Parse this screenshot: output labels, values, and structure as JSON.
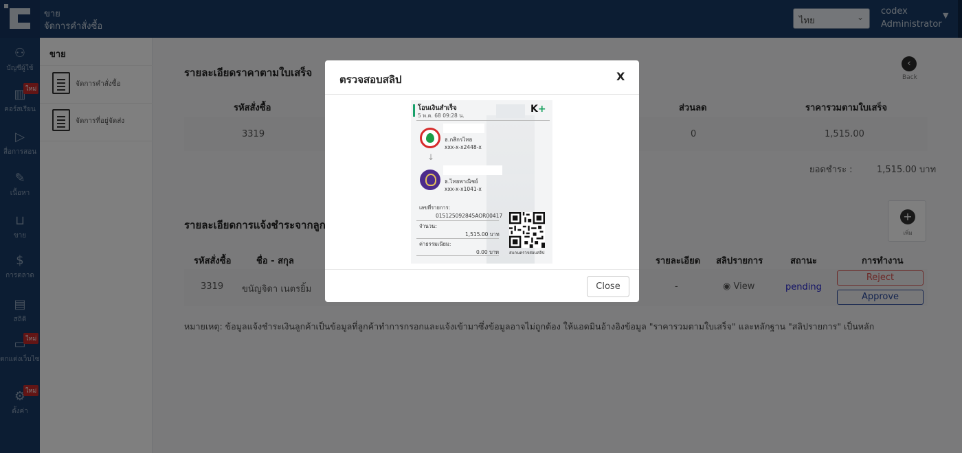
{
  "header": {
    "crumb_section": "ขาย",
    "crumb_page": "จัดการคำสั่งซื้อ",
    "language": "ไทย",
    "user_name": "codex",
    "user_role": "Administrator"
  },
  "rail": {
    "items": [
      {
        "label": "บัญชีผู้ใช้",
        "icon": "users-icon"
      },
      {
        "label": "คอร์สเรียน",
        "icon": "course-icon",
        "badge": "ใหม่"
      },
      {
        "label": "สื่อการสอน",
        "icon": "media-icon"
      },
      {
        "label": "เนื้อหา",
        "icon": "content-icon"
      },
      {
        "label": "ขาย",
        "icon": "basket-icon"
      },
      {
        "label": "การตลาด",
        "icon": "marketing-icon"
      },
      {
        "label": "สถิติ",
        "icon": "stats-icon"
      },
      {
        "label": "ตกแต่งเว็บไซต์",
        "icon": "website-icon",
        "badge": "ใหม่"
      },
      {
        "label": "ตั้งค่า",
        "icon": "settings-icon",
        "badge": "ใหม่"
      }
    ]
  },
  "submenu": {
    "title": "ขาย",
    "items": [
      {
        "label": "จัดการคำสั่งซื้อ"
      },
      {
        "label": "จัดการที่อยู่จัดส่ง"
      }
    ]
  },
  "invoice": {
    "title": "รายละเอียดราคาตามใบเสร็จ",
    "col_order_id": "รหัสสั่งซื้อ",
    "col_discount": "ส่วนลด",
    "col_total": "ราคารวมตามใบเสร็จ",
    "order_id": "3319",
    "discount": "0",
    "total": "1,515.00",
    "paid_label": "ยอดชำระ :",
    "paid_value": "1,515.00 บาท",
    "back_label": "Back"
  },
  "payment": {
    "title": "รายละเอียดการแจ้งชำระจากลูกค้า",
    "add_label": "เพิ่ม",
    "columns": {
      "order_id": "รหัสสั่งซื้อ",
      "name": "ชื่อ - สกุล",
      "detail": "รายละเอียด",
      "slip": "สลิปรายการ",
      "status": "สถานะ",
      "action": "การทำงาน"
    },
    "row": {
      "order_id": "3319",
      "name": "ขนัญจิดา เนตรยิ้ม",
      "detail": "-",
      "slip_btn": "View",
      "status": "pending",
      "reject": "Reject",
      "approve": "Approve"
    },
    "note": "หมายเหตุ: ข้อมูลแจ้งชำระเงินลูกค้าเป็นข้อมูลที่ลูกค้าทำการกรอกและแจ้งเข้ามาซึ่งข้อมูลอาจไม่ถูกต้อง ให้แอดมินอ้างอิงข้อมูล \"ราคารวมตามใบเสร็จ\" และหลักฐาน \"สลิปรายการ\" เป็นหลัก"
  },
  "modal": {
    "title": "ตรวจสอบสลิป",
    "close_x": "X",
    "close_button": "Close",
    "slip": {
      "status": "โอนเงินสำเร็จ",
      "datetime": "5 พ.ค. 68  09:28 น.",
      "brand": "K",
      "brand_plus": "+",
      "from_bank": "ธ.กสิกรไทย",
      "from_account": "xxx-x-x2448-x",
      "to_bank": "ธ.ไทยพาณิชย์",
      "to_account": "xxx-x-x1041-x",
      "ref_label": "เลขที่รายการ:",
      "ref_value": "015125092845AOR00417",
      "amount_label": "จำนวน:",
      "amount_value": "1,515.00 บาท",
      "fee_label": "ค่าธรรมเนียม:",
      "fee_value": "0.00 บาท",
      "qr_label": "สแกนตรวจสอบสลิป"
    }
  },
  "colors": {
    "topbar": "#183b66",
    "reject": "#d9534f",
    "approve": "#2a4a9f",
    "pending": "#2222cc"
  }
}
